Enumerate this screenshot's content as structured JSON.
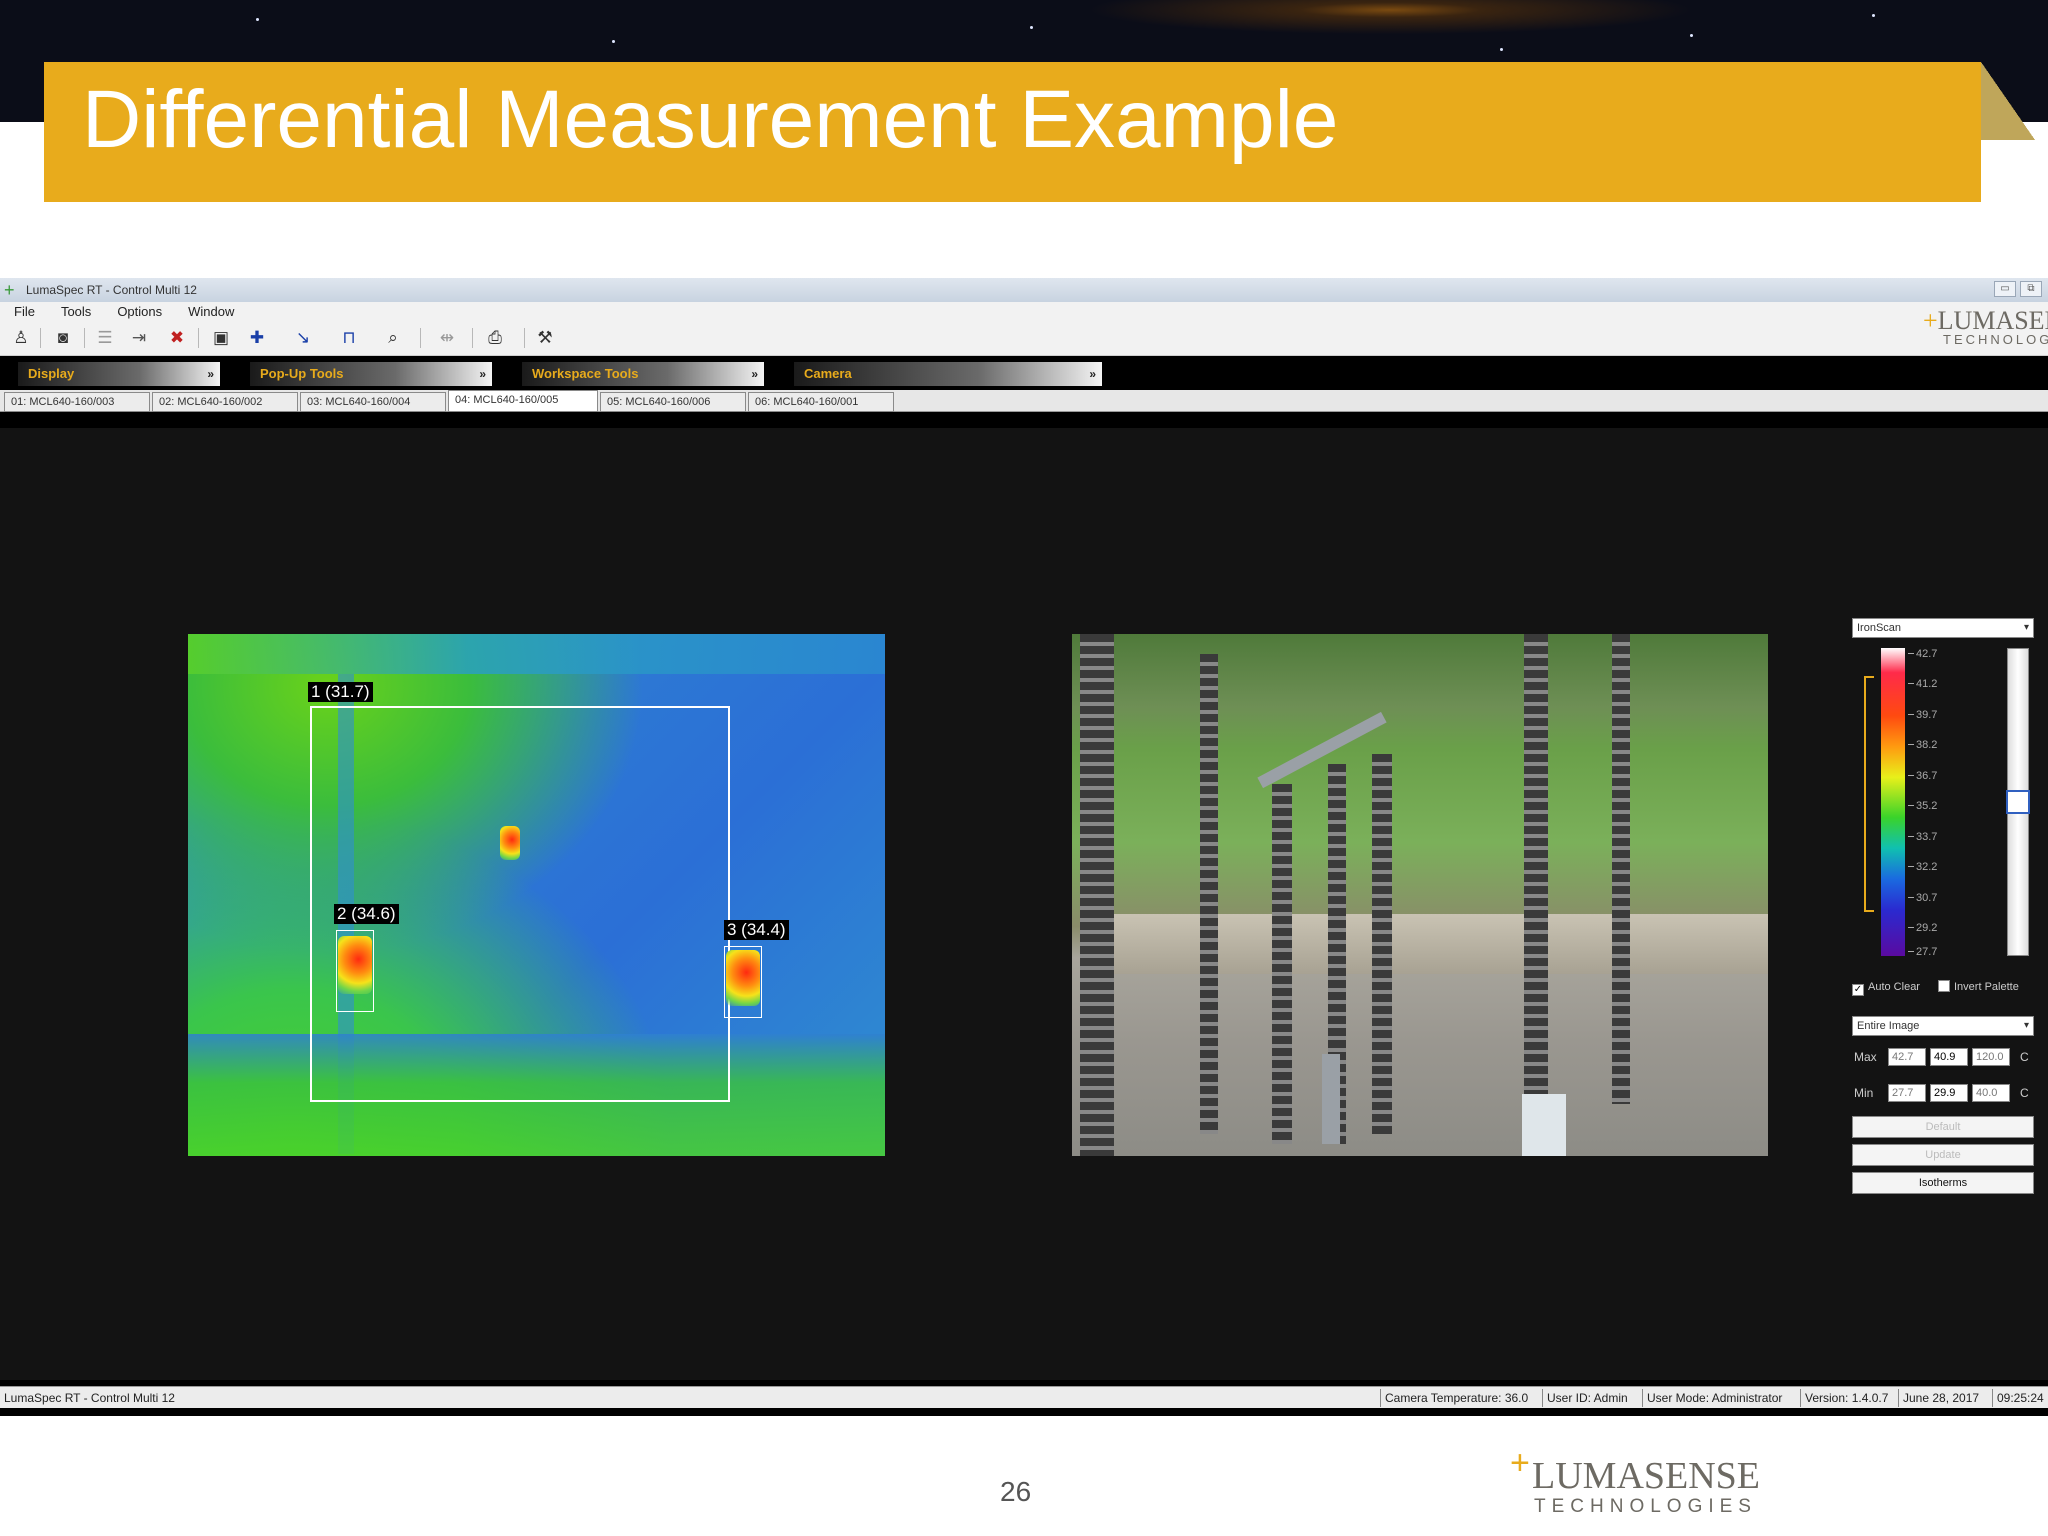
{
  "slide": {
    "title": "Differential Measurement Example",
    "page_number": "26",
    "logo": {
      "name": "LUMASENSE",
      "sub": "TECHNOLOGIES"
    }
  },
  "window": {
    "title": "LumaSpec RT - Control Multi 12",
    "controls": [
      "▭",
      "⧉"
    ],
    "menu": [
      "File",
      "Tools",
      "Options",
      "Window"
    ],
    "logo": {
      "name": "LUMASEN",
      "sub": "TECHNOLOG"
    }
  },
  "toolbar_icons": [
    "person-icon",
    "camera-icon",
    "list-icon",
    "connect-icon",
    "disconnect-icon",
    "save-icon",
    "add-spot-icon",
    "line-tool-icon",
    "area-tool-icon",
    "zoom-icon",
    "measure-icon",
    "export-icon",
    "tools-icon"
  ],
  "panels": [
    {
      "label": "Display",
      "chev": "»"
    },
    {
      "label": "Pop-Up Tools",
      "chev": "»"
    },
    {
      "label": "Workspace Tools",
      "chev": "»"
    },
    {
      "label": "Camera",
      "chev": "»"
    }
  ],
  "tabs": [
    {
      "label": "01: MCL640-160/003",
      "active": false
    },
    {
      "label": "02: MCL640-160/002",
      "active": false
    },
    {
      "label": "03: MCL640-160/004",
      "active": false
    },
    {
      "label": "04: MCL640-160/005",
      "active": true
    },
    {
      "label": "05: MCL640-160/006",
      "active": false
    },
    {
      "label": "06: MCL640-160/001",
      "active": false
    }
  ],
  "measurements": [
    {
      "label": "1 (31.7)",
      "value": 31.7
    },
    {
      "label": "2 (34.6)",
      "value": 34.6
    },
    {
      "label": "3 (34.4)",
      "value": 34.4
    }
  ],
  "palette": {
    "selected": "IronScan",
    "scale": [
      "42.7",
      "41.2",
      "39.7",
      "38.2",
      "36.7",
      "35.2",
      "33.7",
      "32.2",
      "30.7",
      "29.2",
      "27.7"
    ],
    "auto_clear": {
      "label": "Auto Clear",
      "checked": true
    },
    "invert_palette": {
      "label": "Invert Palette",
      "checked": false
    },
    "region": "Entire Image",
    "max": {
      "label": "Max",
      "values": [
        "42.7",
        "40.9",
        "120.0"
      ],
      "unit": "C"
    },
    "min": {
      "label": "Min",
      "values": [
        "27.7",
        "29.9",
        "40.0"
      ],
      "unit": "C"
    },
    "buttons": [
      {
        "label": "Default",
        "enabled": false
      },
      {
        "label": "Update",
        "enabled": false
      },
      {
        "label": "Isotherms",
        "enabled": true
      }
    ]
  },
  "status": {
    "left": "LumaSpec RT - Control Multi 12",
    "segments": [
      "Camera Temperature: 36.0",
      "User ID: Admin",
      "User Mode: Administrator",
      "Version: 1.4.0.7",
      "June 28, 2017",
      "09:25:24"
    ]
  }
}
